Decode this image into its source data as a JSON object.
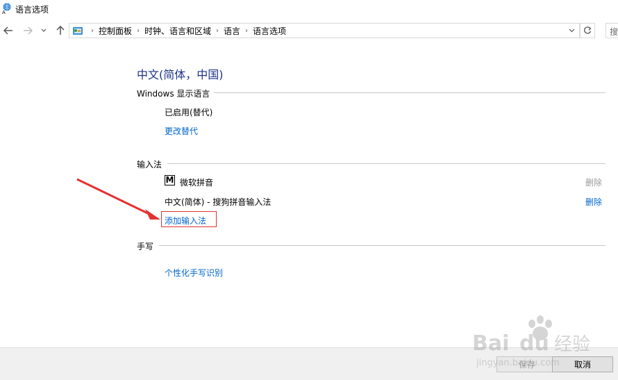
{
  "window": {
    "title": "语言选项"
  },
  "breadcrumbs": [
    "控制面板",
    "时钟、语言和区域",
    "语言",
    "语言选项"
  ],
  "search": {
    "placeholder": "搜"
  },
  "language_name": "中文(简体，中国)",
  "windows_display_language": {
    "section_title": "Windows 显示语言",
    "status": "已启用(替代)",
    "change_link": "更改替代"
  },
  "input_methods": {
    "section_title": "输入法",
    "items": [
      {
        "icon_letter": "M",
        "name": "微软拼音",
        "remove_label": "删除",
        "remove_enabled": false
      },
      {
        "name": "中文(简体) - 搜狗拼音输入法",
        "remove_label": "删除",
        "remove_enabled": true
      }
    ],
    "add_link": "添加输入法"
  },
  "handwriting": {
    "section_title": "手写",
    "personalize_link": "个性化手写识别"
  },
  "footer": {
    "save_label": "保存",
    "cancel_label": "取消"
  },
  "watermark": {
    "brand": "Bai du 经验",
    "url": "jingyan.baidu.com"
  },
  "icons": {
    "app": "language-globe-icon",
    "back": "arrow-left-icon",
    "forward": "arrow-right-icon",
    "recent": "chevron-down-icon",
    "up": "arrow-up-icon",
    "control_panel": "control-panel-icon",
    "refresh": "refresh-icon"
  },
  "colors": {
    "heading": "#1e3287",
    "link": "#0066cc",
    "disabled": "#9a9a9a",
    "highlight": "#e33232",
    "arrow": "#e33232"
  }
}
